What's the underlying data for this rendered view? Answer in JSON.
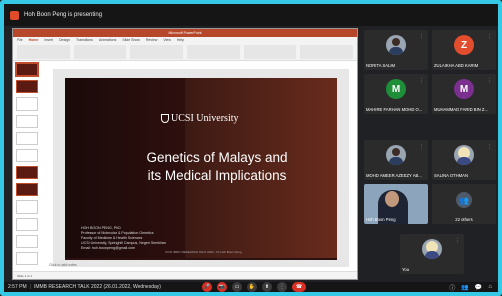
{
  "app": {
    "presenting_text": "Hoh Boon Peng is presenting"
  },
  "powerpoint": {
    "window_title": "Microsoft PowerPoint",
    "tabs": [
      "File",
      "Home",
      "Insert",
      "Design",
      "Transitions",
      "Animations",
      "Slide Show",
      "Review",
      "View",
      "Help"
    ],
    "notes_placeholder": "Click to add notes",
    "status_left": "Slide 1 of 1",
    "slide": {
      "university": "UCSI University",
      "title_line1": "Genetics of Malays and",
      "title_line2": "its Medical Implications",
      "speaker_lines": [
        "HOH BOON PENG, PhD",
        "Professor of Molecular & Population Genetics",
        "Faculty of Medicine & Health Sciences",
        "UCSI University, Springhill Campus, Negeri Sembilan",
        "Email: hoh.boonpeng@gmail.com"
      ],
      "footer": "UCSI IMRC RESEARCH TALK 2022 - Dr Hoh Boon Peng"
    }
  },
  "participants": [
    {
      "name": "NORITA SALIM",
      "type": "photo"
    },
    {
      "name": "ZULAIKHA ABD KARIM",
      "type": "initial",
      "initial": "Z",
      "color": "#e24d2e"
    },
    {
      "name": "MAHIRE FARHAN MOHD O...",
      "type": "initial",
      "initial": "M",
      "color": "#1e8f38"
    },
    {
      "name": "MUHAMMAD FARID BIN Z...",
      "type": "initial",
      "initial": "M",
      "color": "#7b2f8f"
    },
    {
      "name": "MOHD AMEER AZEEZY AB...",
      "type": "photo"
    },
    {
      "name": "SALINA OTHMAN",
      "type": "photo_hijab"
    },
    {
      "name": "Hoh Boon Peng",
      "type": "video"
    },
    {
      "name": "22 others",
      "type": "others"
    },
    {
      "name": "You",
      "type": "photo_hijab"
    }
  ],
  "bottom_bar": {
    "time": "2:57 PM",
    "meeting_title": "IMMB RESEARCH TALK 2022 (26.01.2022, Wednesday)"
  },
  "icons": {
    "mic": "mic-icon",
    "video": "video-icon",
    "present": "present-icon",
    "raise_hand": "raise-hand-icon",
    "more": "more-icon",
    "end_call": "end-call-icon",
    "info": "info-icon",
    "people": "people-icon",
    "chat": "chat-icon",
    "activities": "activities-icon"
  },
  "colors": {
    "frame": "#36c9e6",
    "presenting": "#e04b2a",
    "end_call": "#d93025"
  }
}
